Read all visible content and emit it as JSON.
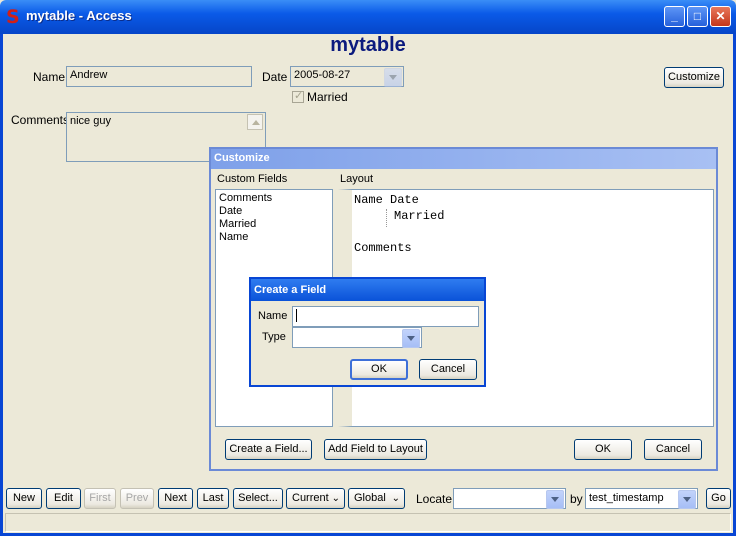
{
  "window": {
    "title": "mytable - Access",
    "controls": [
      "minimize",
      "maximize",
      "close"
    ]
  },
  "form": {
    "title": "mytable",
    "name_label": "Name",
    "name_value": "Andrew",
    "date_label": "Date",
    "date_value": "2005-08-27",
    "married_label": "Married",
    "married_checked": true,
    "comments_label": "Comments",
    "comments_value": "nice guy",
    "customize_button": "Customize"
  },
  "customize_dialog": {
    "title": "Customize",
    "custom_fields_label": "Custom Fields",
    "custom_fields": [
      "Comments",
      "Date",
      "Married",
      "Name"
    ],
    "layout_label": "Layout",
    "layout_lines": {
      "line1": "Name Date",
      "line2": "Married",
      "line3": "Comments"
    },
    "create_field_button": "Create a Field...",
    "add_field_button": "Add Field to Layout",
    "ok_button": "OK",
    "cancel_button": "Cancel"
  },
  "create_field_dialog": {
    "title": "Create a Field",
    "name_label": "Name",
    "name_value": "",
    "type_label": "Type",
    "type_value": "",
    "ok_button": "OK",
    "cancel_button": "Cancel"
  },
  "toolbar": {
    "new": "New",
    "edit": "Edit",
    "first": "First",
    "prev": "Prev",
    "next": "Next",
    "last": "Last",
    "select": "Select...",
    "current": "Current",
    "global": "Global",
    "locate_label": "Locate",
    "locate_value": "",
    "by_label": "by",
    "by_value": "test_timestamp",
    "go": "Go"
  },
  "colors": {
    "title_bar": "#0a5ae8",
    "form_title": "#0b1a7e",
    "dialog_bg": "#ece9d8"
  }
}
